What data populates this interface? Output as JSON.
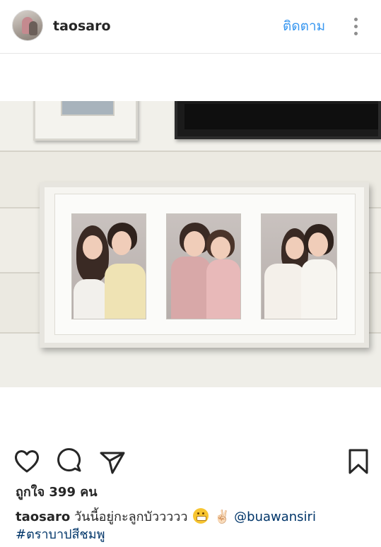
{
  "header": {
    "username": "taosaro",
    "follow_label": "ติดตาม"
  },
  "post": {
    "likes_text": "ถูกใจ 399 คน",
    "caption_user": "taosaro",
    "caption_text": "วันนี้อยู่กะลูกบัววววว",
    "caption_emoji": "😁",
    "caption_peace": "✌🏻",
    "caption_mention": "@buawansiri",
    "caption_hashtag": "#ตราบาปสีชมพู"
  },
  "icons": {
    "like": "heart-icon",
    "comment": "comment-icon",
    "share": "send-icon",
    "save": "bookmark-icon",
    "more": "more-vertical-icon"
  },
  "colors": {
    "follow": "#3897f0",
    "link": "#003569",
    "text": "#262626"
  }
}
